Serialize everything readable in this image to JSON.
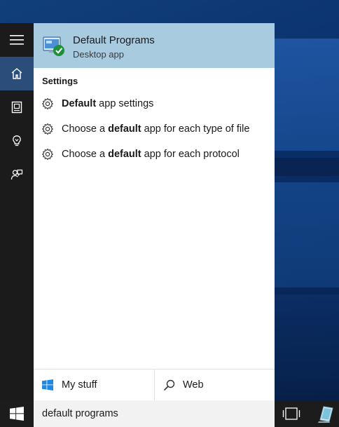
{
  "top_result": {
    "title": "Default Programs",
    "subtitle": "Desktop app",
    "icon": "default-programs-icon"
  },
  "settings": {
    "header": "Settings",
    "items": [
      {
        "pre": "",
        "bold": "Default",
        "post": " app settings",
        "icon": "gear-icon"
      },
      {
        "pre": "Choose a ",
        "bold": "default",
        "post": " app for each type of file",
        "icon": "gear-icon"
      },
      {
        "pre": "Choose a ",
        "bold": "default",
        "post": " app for each protocol",
        "icon": "gear-icon"
      }
    ]
  },
  "rail": {
    "items": [
      {
        "icon": "hamburger-menu-icon",
        "active": false
      },
      {
        "icon": "home-icon",
        "active": true
      },
      {
        "icon": "notebook-icon",
        "active": false
      },
      {
        "icon": "lightbulb-icon",
        "active": false
      },
      {
        "icon": "feedback-icon",
        "active": false
      }
    ]
  },
  "filters": {
    "my_stuff": "My stuff",
    "web": "Web"
  },
  "search": {
    "value": "default programs"
  },
  "colors": {
    "rail_bg": "#1b1b1b",
    "rail_active": "#2b4d7a",
    "top_result_bg": "#a9cbe0",
    "taskbar_bg": "#1c1c1c",
    "search_bg": "#f2f2f2",
    "windows_blue": "#1e88e5"
  }
}
